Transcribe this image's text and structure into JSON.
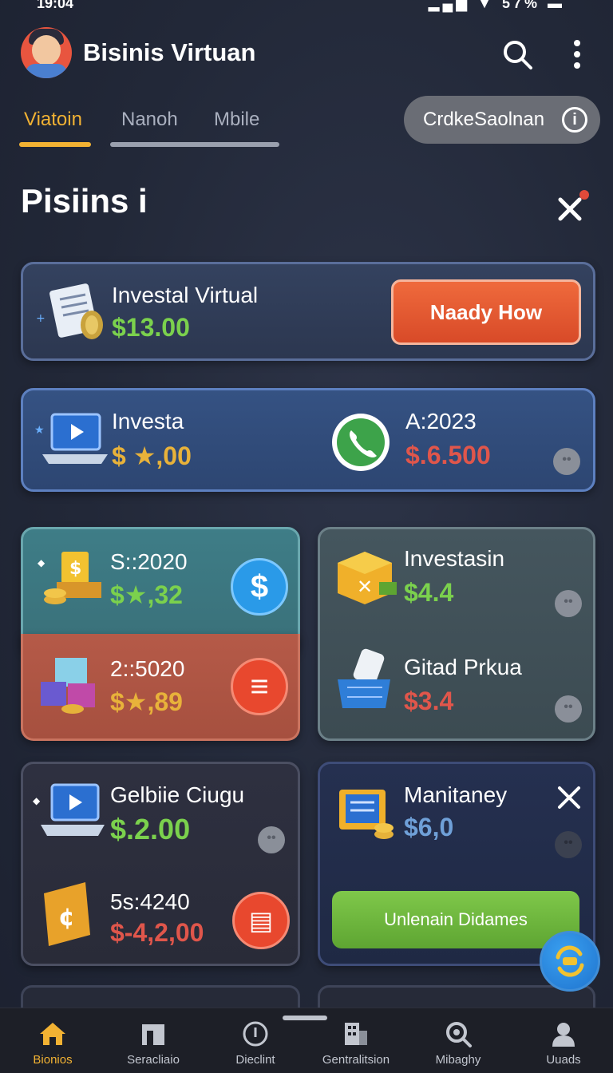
{
  "status": {
    "time": "19:04",
    "battery": "57%"
  },
  "app": {
    "title": "Bisinis Virtuan"
  },
  "tabs": [
    {
      "label": "Viatoin",
      "active": true
    },
    {
      "label": "Nanoh",
      "active": false
    },
    {
      "label": "Mbile",
      "active": false
    }
  ],
  "pill": {
    "label": "CrdkeSaolnan"
  },
  "section": {
    "title": "Pisiins i"
  },
  "cards": {
    "row1": {
      "label": "Investal Virtual",
      "amount": "$13.00",
      "button": "Naady How"
    },
    "row2": {
      "label": "Investa",
      "amount": "$ ★,00",
      "right_label": "A:2023",
      "right_amount": "$.6.500"
    },
    "teal": {
      "label": "S::2020",
      "amount": "$★,32"
    },
    "brick": {
      "label": "2::5020",
      "amount": "$★,89"
    },
    "slate_top": {
      "label": "Investasin",
      "amount": "$4.4"
    },
    "slate_bottom": {
      "label": "Gitad Prkua",
      "amount": "$3.4"
    },
    "dark_top": {
      "label": "Gelbiie Ciugu",
      "amount": "$.2.00"
    },
    "dark_bottom": {
      "label": "5s:4240",
      "amount": "$-4,2,00"
    },
    "navy": {
      "label": "Manitaney",
      "amount": "$6,0",
      "button": "Unlenain Didames"
    }
  },
  "bottom_nav": [
    {
      "label": "Bionios",
      "icon": "home-icon",
      "active": true
    },
    {
      "label": "Seracliaio",
      "icon": "store-icon",
      "active": false
    },
    {
      "label": "Dieclint",
      "icon": "compass-icon",
      "active": false
    },
    {
      "label": "Gentralitsion",
      "icon": "building-icon",
      "active": false
    },
    {
      "label": "Mibaghy",
      "icon": "magnifier-icon",
      "active": false
    },
    {
      "label": "Uuads",
      "icon": "user-icon",
      "active": false
    }
  ],
  "colors": {
    "accent": "#f2b233",
    "positive": "#7bd14d",
    "negative": "#e0564b"
  }
}
